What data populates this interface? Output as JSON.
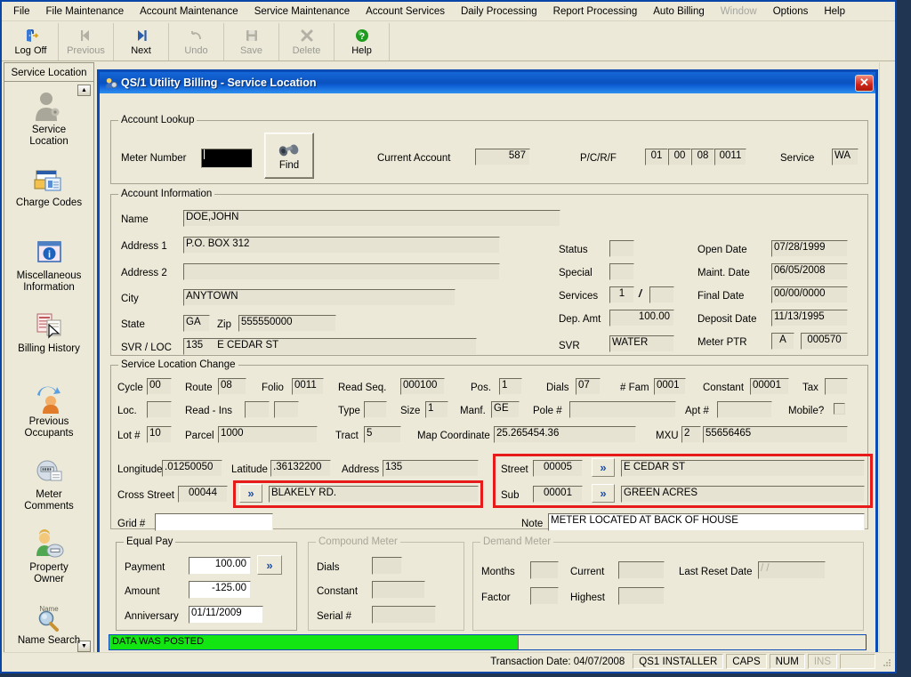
{
  "menubar": {
    "items": [
      {
        "label": "File",
        "disabled": false
      },
      {
        "label": "File Maintenance",
        "disabled": false
      },
      {
        "label": "Account Maintenance",
        "disabled": false
      },
      {
        "label": "Service Maintenance",
        "disabled": false
      },
      {
        "label": "Account Services",
        "disabled": false
      },
      {
        "label": "Daily Processing",
        "disabled": false
      },
      {
        "label": "Report Processing",
        "disabled": false
      },
      {
        "label": "Auto Billing",
        "disabled": false
      },
      {
        "label": "Window",
        "disabled": true
      },
      {
        "label": "Options",
        "disabled": false
      },
      {
        "label": "Help",
        "disabled": false
      }
    ]
  },
  "toolbar": {
    "buttons": [
      {
        "label": "Log Off",
        "icon": "logoff-icon",
        "disabled": false
      },
      {
        "label": "Previous",
        "icon": "previous-icon",
        "disabled": true
      },
      {
        "label": "Next",
        "icon": "next-icon",
        "disabled": false
      },
      {
        "label": "Undo",
        "icon": "undo-icon",
        "disabled": true
      },
      {
        "label": "Save",
        "icon": "save-icon",
        "disabled": true
      },
      {
        "label": "Delete",
        "icon": "delete-icon",
        "disabled": true
      },
      {
        "label": "Help",
        "icon": "help-icon",
        "disabled": false
      }
    ]
  },
  "sidebar": {
    "tab_label": "Service Location",
    "items": [
      {
        "label": "Service\nLocation",
        "icon": "person-icon"
      },
      {
        "label": "Charge Codes",
        "icon": "cards-icon"
      },
      {
        "label": "Miscellaneous\nInformation",
        "icon": "info-window-icon"
      },
      {
        "label": "Billing History",
        "icon": "billing-history-icon"
      },
      {
        "label": "Previous\nOccupants",
        "icon": "previous-occupants-icon"
      },
      {
        "label": "Meter\nComments",
        "icon": "meter-comments-icon"
      },
      {
        "label": "Property\nOwner",
        "icon": "property-owner-icon"
      },
      {
        "label": "Name Search",
        "icon": "name-search-icon"
      }
    ]
  },
  "dialog": {
    "title": "QS/1 Utility Billing - Service Location",
    "close_label": "✕",
    "account_lookup": {
      "caption": "Account Lookup",
      "meter_number_label": "Meter Number",
      "meter_number_value": "",
      "find_label": "Find",
      "current_account_label": "Current Account",
      "current_account_value": "587",
      "pcrf_label": "P/C/R/F",
      "pcrf_values": [
        "01",
        "00",
        "08",
        "0011"
      ],
      "service_label": "Service",
      "service_value": "WA"
    },
    "account_information": {
      "caption": "Account Information",
      "name_label": "Name",
      "name_value": "DOE,JOHN",
      "address1_label": "Address 1",
      "address1_value": "P.O. BOX 312",
      "address2_label": "Address 2",
      "address2_value": "",
      "city_label": "City",
      "city_value": "ANYTOWN",
      "state_label": "State",
      "state_value": "GA",
      "zip_label": "Zip",
      "zip_value": "555550000",
      "svrloc_label": "SVR / LOC",
      "svrloc_num": "135",
      "svrloc_street": "E CEDAR ST",
      "status_label": "Status",
      "status_value": "",
      "special_label": "Special",
      "special_value": "",
      "services_label": "Services",
      "services_value1": "1",
      "services_sep": "/",
      "services_value2": "",
      "dep_amt_label": "Dep. Amt",
      "dep_amt_value": "100.00",
      "svr_label": "SVR",
      "svr_value": "WATER",
      "open_date_label": "Open Date",
      "open_date_value": "07/28/1999",
      "maint_date_label": "Maint. Date",
      "maint_date_value": "06/05/2008",
      "final_date_label": "Final Date",
      "final_date_value": "00/00/0000",
      "deposit_date_label": "Deposit Date",
      "deposit_date_value": "11/13/1995",
      "meter_ptr_label": "Meter PTR",
      "meter_ptr_a": "A",
      "meter_ptr_num": "000570"
    },
    "service_location_change": {
      "caption": "Service Location Change",
      "cycle_label": "Cycle",
      "cycle_value": "00",
      "route_label": "Route",
      "route_value": "08",
      "folio_label": "Folio",
      "folio_value": "0011",
      "read_seq_label": "Read Seq.",
      "read_seq_value": "000100",
      "pos_label": "Pos.",
      "pos_value": "1",
      "dials_label": "Dials",
      "dials_value": "07",
      "fam_label": "# Fam",
      "fam_value": "0001",
      "constant_label": "Constant",
      "constant_value": "00001",
      "tax_label": "Tax",
      "tax_value": "",
      "loc_label": "Loc.",
      "loc_value": "",
      "read_ins_label": "Read - Ins",
      "read_ins_value1": "",
      "read_ins_value2": "",
      "type_label": "Type",
      "type_value": "",
      "size_label": "Size",
      "size_value": "1",
      "manf_label": "Manf.",
      "manf_value": "GE",
      "pole_label": "Pole #",
      "pole_value": "",
      "apt_label": "Apt #",
      "apt_value": "",
      "mobile_label": "Mobile?",
      "lot_label": "Lot #",
      "lot_value": "10",
      "parcel_label": "Parcel",
      "parcel_value": "1000",
      "tract_label": "Tract",
      "tract_value": "5",
      "map_coord_label": "Map Coordinate",
      "map_coord_value": "25.265454.36",
      "mxu_label": "MXU",
      "mxu_value1": "2",
      "mxu_value2": "55656465",
      "longitude_label": "Longitude",
      "longitude_value": ".01250050",
      "latitude_label": "Latitude",
      "latitude_value": ".36132200",
      "address_label": "Address",
      "address_value": "135",
      "cross_street_label": "Cross Street",
      "cross_street_code": "00044",
      "cross_street_name": "BLAKELY RD.",
      "street_label": "Street",
      "street_code": "00005",
      "street_name": "E CEDAR ST",
      "sub_label": "Sub",
      "sub_code": "00001",
      "sub_name": "GREEN ACRES",
      "grid_label": "Grid #",
      "grid_value": "",
      "note_label": "Note",
      "note_value": "METER LOCATED AT BACK OF HOUSE",
      "chevron_icon": "double-chevron-right-icon"
    },
    "equal_pay": {
      "caption": "Equal Pay",
      "payment_label": "Payment",
      "payment_value": "100.00",
      "amount_label": "Amount",
      "amount_value": "-125.00",
      "anniversary_label": "Anniversary",
      "anniversary_value": "01/11/2009"
    },
    "compound_meter": {
      "caption": "Compound Meter",
      "dials_label": "Dials",
      "dials_value": "",
      "constant_label": "Constant",
      "constant_value": "",
      "serial_label": "Serial #",
      "serial_value": ""
    },
    "demand_meter": {
      "caption": "Demand Meter",
      "months_label": "Months",
      "months_value": "",
      "factor_label": "Factor",
      "factor_value": "",
      "current_label": "Current",
      "current_value": "",
      "highest_label": "Highest",
      "highest_value": "",
      "last_reset_label": "Last Reset Date",
      "last_reset_value": "/  /"
    },
    "status": {
      "message": "DATA WAS POSTED"
    }
  },
  "statusbar": {
    "transaction_date": "Transaction Date: 04/07/2008",
    "user": "QS1 INSTALLER",
    "caps": "CAPS",
    "num": "NUM",
    "ins": "INS"
  },
  "colors": {
    "accent_blue": "#0b4bb5",
    "highlight_red": "#e81b1b",
    "status_green": "#12e512",
    "window_face": "#ece9d8"
  }
}
